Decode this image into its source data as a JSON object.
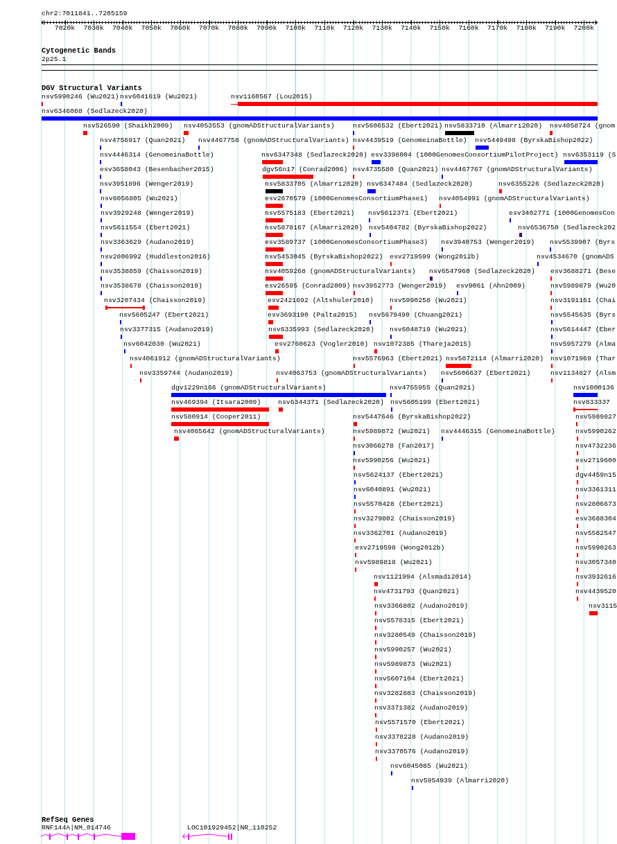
{
  "ruler": {
    "position": "chr2:7011841..7205159",
    "ticks": [
      "7020k",
      "7030k",
      "7040k",
      "7050k",
      "7060k",
      "7070k",
      "7080k",
      "7090k",
      "7100k",
      "7110k",
      "7120k",
      "7130k",
      "7140k",
      "7150k",
      "7160k",
      "7170k",
      "7180k",
      "7190k",
      "7200k"
    ]
  },
  "cytoband_track": {
    "title": "Cytogenetic Bands",
    "band": "2p25.1"
  },
  "dgv_track": {
    "title": "DGV Structural Variants",
    "variants": [
      {
        "label": "nsv5990246 (Wu2021)",
        "color": "#ff0000",
        "kind": "bar"
      },
      {
        "label": "nsv6041619 (Wu2021)",
        "color": "#0000ff",
        "kind": "bar"
      },
      {
        "label": "nsv1160567 (Lou2015)",
        "color": "#ff0000",
        "kind": "bar"
      },
      {
        "label": "nsv6346088 (Sedlazeck2020)",
        "color": "#0000ff",
        "kind": "bar"
      },
      {
        "label": "nsv526590 (Shaikh2009)",
        "color": "#ff0000",
        "kind": "bar"
      },
      {
        "label": "nsv4053553 (gnomADStructuralVariants)",
        "color": "#ff0000",
        "kind": "bar"
      },
      {
        "label": "nsv5606532 (Ebert2021)",
        "color": "#0000ff",
        "kind": "bar"
      },
      {
        "label": "nsv5833710 (Almarri2020)",
        "color": "#000000",
        "kind": "bar"
      },
      {
        "label": "nsv4058724 (gnom",
        "color": "#ff0000",
        "kind": "bar"
      },
      {
        "label": "nsv4756917 (Quan2021)",
        "color": "#0000ff",
        "kind": "bar"
      },
      {
        "label": "nsv4467758 (gnomADStructuralVariants)",
        "color": "#0000ff",
        "kind": "bar"
      },
      {
        "label": "nsv4439519 (GenomeinaBottle)",
        "color": "#ff0000",
        "kind": "bar"
      },
      {
        "label": "nsv5449498 (ByrskaBishop2022)",
        "color": "#0000ff",
        "kind": "bar"
      },
      {
        "label": "nsv4446314 (GenomeinaBottle)",
        "color": "#0000ff",
        "kind": "bar"
      },
      {
        "label": "nsv6347348 (Sedlazeck2020)",
        "color": "#ff0000",
        "kind": "bar"
      },
      {
        "label": "esv3398004 (1000GenomesConsortiumPilotProject)",
        "color": "#0000ff",
        "kind": "bar"
      },
      {
        "label": "nsv6353119 (S",
        "color": "#0000ff",
        "kind": "bar"
      },
      {
        "label": "esv3658043 (Besenbacher2015)",
        "color": "#0000ff",
        "kind": "bar"
      },
      {
        "label": "dgv56n17 (Conrad2006)",
        "color": "#ff0000",
        "kind": "bar"
      },
      {
        "label": "nsv4735580 (Quan2021)",
        "color": "#ff0000",
        "kind": "bar"
      },
      {
        "label": "nsv4467767 (gnomADStructuralVariants)",
        "color": "#0000ff",
        "kind": "bar"
      },
      {
        "label": "nsv3951896 (Wenger2019)",
        "color": "#0000ff",
        "kind": "bar"
      },
      {
        "label": "nsv5833705 (Almarri2020)",
        "color": "#000000",
        "kind": "bar"
      },
      {
        "label": "nsv6347484 (Sedlazeck2020)",
        "color": "#0000ff",
        "kind": "bar"
      },
      {
        "label": "nsv6355226 (Sedlazeck2020)",
        "color": "#ff0000",
        "kind": "bar"
      },
      {
        "label": "nsv6056805 (Wu2021)",
        "color": "#0000ff",
        "kind": "bar"
      },
      {
        "label": "esv2670579 (1000GenomesConsortiumPhase1)",
        "color": "#ff0000",
        "kind": "bar"
      },
      {
        "label": "nsv4054991 (gnomADStructuralVariants)",
        "color": "#ff0000",
        "kind": "bar"
      },
      {
        "label": "nsv3929248 (Wenger2019)",
        "color": "#0000ff",
        "kind": "bar"
      },
      {
        "label": "nsv5575183 (Ebert2021)",
        "color": "#ff0000",
        "kind": "bar"
      },
      {
        "label": "nsv5612371 (Ebert2021)",
        "color": "#0000ff",
        "kind": "bar"
      },
      {
        "label": "esv3402771 (1000GenomesCon",
        "color": "#0000ff",
        "kind": "bar"
      },
      {
        "label": "nsv5611554 (Ebert2021)",
        "color": "#0000ff",
        "kind": "bar"
      },
      {
        "label": "nsv5878167 (Almarri2020)",
        "color": "#ff0000",
        "kind": "bar"
      },
      {
        "label": "nsv5404782 (ByrskaBishop2022)",
        "color": "#0000ff",
        "kind": "bar"
      },
      {
        "label": "nsv6536750 (Sedlazeck202",
        "color": "#4b0082",
        "kind": "bar"
      },
      {
        "label": "nsv3363629 (Audano2019)",
        "color": "#0000ff",
        "kind": "bar"
      },
      {
        "label": "esv3589737 (1000GenomesConsortiumPhase3)",
        "color": "#ff0000",
        "kind": "bar"
      },
      {
        "label": "nsv3940753 (Wenger2019)",
        "color": "#0000ff",
        "kind": "bar"
      },
      {
        "label": "nsv5539907 (Byrs",
        "color": "#0000ff",
        "kind": "bar"
      },
      {
        "label": "nsv2806992 (Huddleston2016)",
        "color": "#0000ff",
        "kind": "bar"
      },
      {
        "label": "nsv5453045 (ByrskaBishop2022)",
        "color": "#ff0000",
        "kind": "bar"
      },
      {
        "label": "esv2719599 (Wong2012b)",
        "color": "#ff0000",
        "kind": "bar"
      },
      {
        "label": "nsv4534670 (gnomADS",
        "color": "#0000ff",
        "kind": "bar"
      },
      {
        "label": "nsv3538859 (Chaisson2019)",
        "color": "#0000ff",
        "kind": "bar"
      },
      {
        "label": "nsv4059268 (gnomADStructuralVariants)",
        "color": "#ff0000",
        "kind": "bar"
      },
      {
        "label": "nsv6547960 (Sedlazeck2020)",
        "color": "#4b0082",
        "kind": "bar"
      },
      {
        "label": "esv3688271 (Bese",
        "color": "#ff0000",
        "kind": "bar"
      },
      {
        "label": "nsv3538678 (Chaisson2019)",
        "color": "#0000ff",
        "kind": "bar"
      },
      {
        "label": "esv26595 (Conrad2009)",
        "color": "#ff0000",
        "kind": "bar"
      },
      {
        "label": "nsv3952773 (Wenger2019)",
        "color": "#ff0000",
        "kind": "bar"
      },
      {
        "label": "esv9061 (Ahn2009)",
        "color": "#0000ff",
        "kind": "bar"
      },
      {
        "label": "nsv5989879 (Wu20",
        "color": "#ff0000",
        "kind": "bar"
      },
      {
        "label": "nsv3207434 (Chaisson2019)",
        "color": "#ff0000",
        "kind": "span"
      },
      {
        "label": "esv2421692 (Altshuler2010)",
        "color": "#ff0000",
        "kind": "bar"
      },
      {
        "label": "nsv5990258 (Wu2021)",
        "color": "#ff0000",
        "kind": "bar"
      },
      {
        "label": "nsv3191161 (Chai",
        "color": "#ff0000",
        "kind": "bar"
      },
      {
        "label": "nsv5605247 (Ebert2021)",
        "color": "#0000ff",
        "kind": "bar"
      },
      {
        "label": "esv3693190 (Palta2015)",
        "color": "#ff0000",
        "kind": "bar"
      },
      {
        "label": "nsv5679490 (Chuang2021)",
        "color": "#0000ff",
        "kind": "bar"
      },
      {
        "label": "nsv5545635 (Byrs",
        "color": "#0000ff",
        "kind": "bar"
      },
      {
        "label": "nsv3377315 (Audano2019)",
        "color": "#0000ff",
        "kind": "bar"
      },
      {
        "label": "nsv6335993 (Sedlazeck2020)",
        "color": "#ff0000",
        "kind": "bar"
      },
      {
        "label": "nsv6048719 (Wu2021)",
        "color": "#0000ff",
        "kind": "bar"
      },
      {
        "label": "nsv5614447 (Eber",
        "color": "#0000ff",
        "kind": "bar"
      },
      {
        "label": "nsv6042030 (Wu2021)",
        "color": "#0000ff",
        "kind": "bar"
      },
      {
        "label": "esv2760623 (Vogler2010)",
        "color": "#ff0000",
        "kind": "bar"
      },
      {
        "label": "nsv1072385 (Thareja2015)",
        "color": "#ff0000",
        "kind": "bar"
      },
      {
        "label": "nsv5957279 (Alma",
        "color": "#0000ff",
        "kind": "bar"
      },
      {
        "label": "nsv4061912 (gnomADStructuralVariants)",
        "color": "#ff0000",
        "kind": "bar"
      },
      {
        "label": "nsv5576963 (Ebert2021)",
        "color": "#ff0000",
        "kind": "bar"
      },
      {
        "label": "nsv5872114 (Almarri2020)",
        "color": "#ff0000",
        "kind": "bar"
      },
      {
        "label": "nsv1071969 (Thar",
        "color": "#ff0000",
        "kind": "bar"
      },
      {
        "label": "nsv3359744 (Audano2019)",
        "color": "#ff0000",
        "kind": "bar"
      },
      {
        "label": "nsv4063753 (gnomADStructuralVariants)",
        "color": "#ff0000",
        "kind": "bar"
      },
      {
        "label": "nsv5606637 (Ebert2021)",
        "color": "#0000ff",
        "kind": "bar"
      },
      {
        "label": "nsv1134827 (Alsm",
        "color": "#ff0000",
        "kind": "bar"
      },
      {
        "label": "dgv1229n166 (gnomADStructuralVariants)",
        "color": "#0000ff",
        "kind": "bar"
      },
      {
        "label": "nsv4755955 (Quan2021)",
        "color": "#0000ff",
        "kind": "bar"
      },
      {
        "label": "nsv1000136",
        "color": "#0000ff",
        "kind": "bar"
      },
      {
        "label": "nsv469394 (Itsara2009)",
        "color": "#ff0000",
        "kind": "bar"
      },
      {
        "label": "nsv6344371 (Sedlazeck2020)",
        "color": "#ff0000",
        "kind": "bar"
      },
      {
        "label": "nsv5605199 (Ebert2021)",
        "color": "#0000ff",
        "kind": "bar"
      },
      {
        "label": "nsv833337",
        "color": "#ff0000",
        "kind": "span"
      },
      {
        "label": "nsv580914 (Cooper2011)",
        "color": "#ff0000",
        "kind": "bar"
      },
      {
        "label": "nsv5447646 (ByrskaBishop2022)",
        "color": "#ff0000",
        "kind": "bar"
      },
      {
        "label": "nsv5989827",
        "color": "#ff0000",
        "kind": "bar"
      },
      {
        "label": "nsv4065642 (gnomADStructuralVariants)",
        "color": "#ff0000",
        "kind": "bar"
      },
      {
        "label": "nsv5989872 (Wu2021)",
        "color": "#ff0000",
        "kind": "bar"
      },
      {
        "label": "nsv4446315 (GenomeinaBottle)",
        "color": "#0000ff",
        "kind": "bar"
      },
      {
        "label": "nsv5990262",
        "color": "#ff0000",
        "kind": "bar"
      },
      {
        "label": "nsv3066278 (Fan2017)",
        "color": "#0000ff",
        "kind": "bar"
      },
      {
        "label": "nsv4732236",
        "color": "#ff0000",
        "kind": "bar"
      },
      {
        "label": "nsv5990256 (Wu2021)",
        "color": "#ff0000",
        "kind": "bar"
      },
      {
        "label": "esv2719600",
        "color": "#ff0000",
        "kind": "bar"
      },
      {
        "label": "nsv5624137 (Ebert2021)",
        "color": "#0000ff",
        "kind": "bar"
      },
      {
        "label": "dgv4459n15",
        "color": "#ff0000",
        "kind": "bar"
      },
      {
        "label": "nsv6040891 (Wu2021)",
        "color": "#0000ff",
        "kind": "bar"
      },
      {
        "label": "nsv3361311",
        "color": "#ff0000",
        "kind": "bar"
      },
      {
        "label": "nsv5570428 (Ebert2021)",
        "color": "#ff0000",
        "kind": "bar"
      },
      {
        "label": "nsv2806673",
        "color": "#ff0000",
        "kind": "bar"
      },
      {
        "label": "nsv3279802 (Chaisson2019)",
        "color": "#ff0000",
        "kind": "bar"
      },
      {
        "label": "esv3688304",
        "color": "#ff0000",
        "kind": "bar"
      },
      {
        "label": "nsv3362701 (Audano2019)",
        "color": "#ff0000",
        "kind": "bar"
      },
      {
        "label": "nsv5582547",
        "color": "#ff0000",
        "kind": "bar"
      },
      {
        "label": "esv2719598 (Wong2012b)",
        "color": "#ff0000",
        "kind": "bar"
      },
      {
        "label": "nsv5990263",
        "color": "#ff0000",
        "kind": "bar"
      },
      {
        "label": "nsv5989818 (Wu2021)",
        "color": "#ff0000",
        "kind": "bar"
      },
      {
        "label": "nsv3057340",
        "color": "#ff0000",
        "kind": "bar"
      },
      {
        "label": "nsv1121994 (Alsmadi2014)",
        "color": "#ff0000",
        "kind": "bar"
      },
      {
        "label": "nsv3932616",
        "color": "#ff0000",
        "kind": "bar"
      },
      {
        "label": "nsv4731793 (Quan2021)",
        "color": "#ff0000",
        "kind": "bar"
      },
      {
        "label": "nsv4439520",
        "color": "#ff0000",
        "kind": "bar"
      },
      {
        "label": "nsv3366802 (Audano2019)",
        "color": "#ff0000",
        "kind": "bar"
      },
      {
        "label": "nsv3115",
        "color": "#ff0000",
        "kind": "bar"
      },
      {
        "label": "nsv5578315 (Ebert2021)",
        "color": "#ff0000",
        "kind": "bar"
      },
      {
        "label": "nsv3280549 (Chaisson2019)",
        "color": "#ff0000",
        "kind": "bar"
      },
      {
        "label": "nsv5990257 (Wu2021)",
        "color": "#ff0000",
        "kind": "bar"
      },
      {
        "label": "nsv5989873 (Wu2021)",
        "color": "#ff0000",
        "kind": "bar"
      },
      {
        "label": "nsv5607104 (Ebert2021)",
        "color": "#ff0000",
        "kind": "bar"
      },
      {
        "label": "nsv3282883 (Chaisson2019)",
        "color": "#ff0000",
        "kind": "bar"
      },
      {
        "label": "nsv3371382 (Audano2019)",
        "color": "#ff0000",
        "kind": "bar"
      },
      {
        "label": "nsv5571570 (Ebert2021)",
        "color": "#ff0000",
        "kind": "bar"
      },
      {
        "label": "nsv3378228 (Audano2019)",
        "color": "#ff0000",
        "kind": "bar"
      },
      {
        "label": "nsv3370576 (Audano2019)",
        "color": "#ff0000",
        "kind": "bar"
      },
      {
        "label": "nsv6045085 (Wu2021)",
        "color": "#0000ff",
        "kind": "bar"
      },
      {
        "label": "nsv5954939 (Almarri2020)",
        "color": "#0000ff",
        "kind": "bar"
      }
    ]
  },
  "refseq_track": {
    "title": "RefSeq Genes",
    "genes": [
      {
        "label": "RNF144A|NM_014746"
      },
      {
        "label": "LOC101929452|NR_110252"
      }
    ]
  }
}
